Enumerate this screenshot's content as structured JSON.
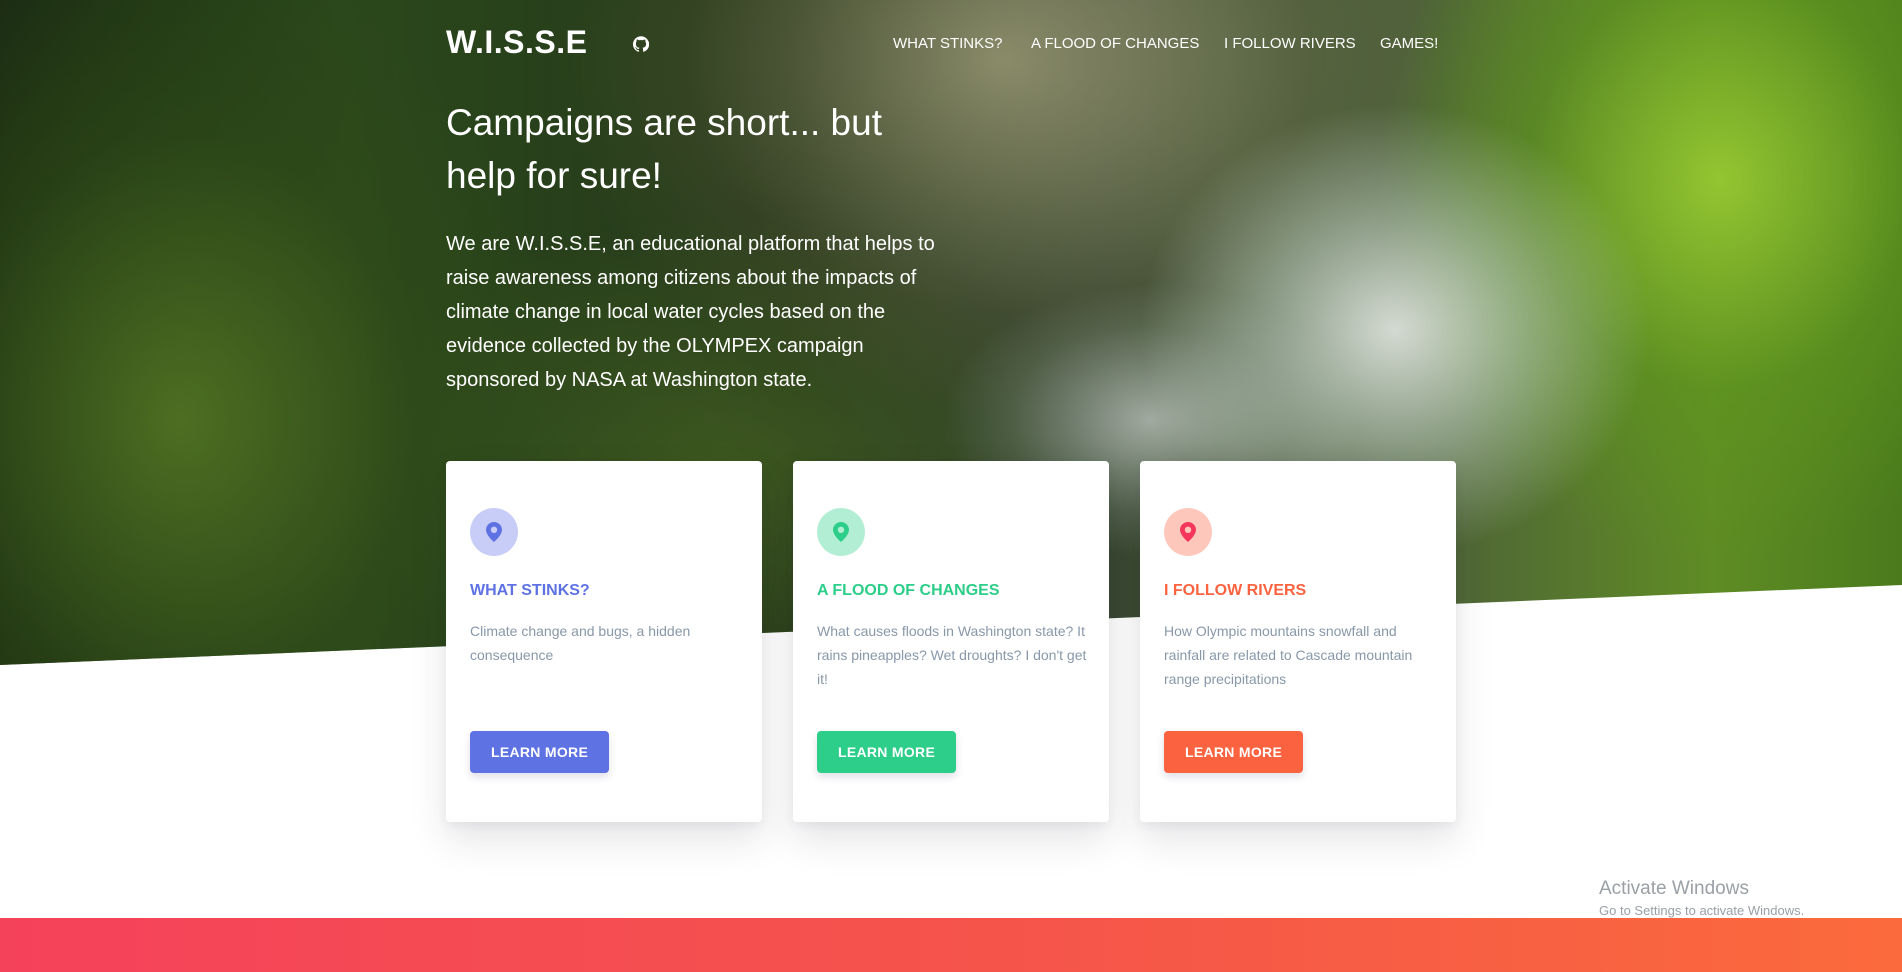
{
  "brand": {
    "name": "W.I.S.S.E",
    "github_icon": "github-icon"
  },
  "nav": {
    "items": [
      {
        "label": "WHAT STINKS?"
      },
      {
        "label": "A FLOOD OF CHANGES"
      },
      {
        "label": "I FOLLOW RIVERS"
      },
      {
        "label": "GAMES!"
      }
    ]
  },
  "hero": {
    "headline": "Campaigns are short... but help for sure!",
    "description": "We are W.I.S.S.E, an educational platform that helps to raise awareness among citizens about the impacts of climate change in local water cycles based on the evidence collected by the OLYMPEX campaign sponsored by NASA at Washington state."
  },
  "cards": [
    {
      "icon": "map-pin-icon",
      "title": "WHAT STINKS?",
      "text": "Climate change and bugs, a hidden consequence",
      "button": "LEARN MORE",
      "accent": "#5e72e4",
      "icon_bg": "#c7cdf7"
    },
    {
      "icon": "map-pin-icon",
      "title": "A FLOOD OF CHANGES",
      "text": "What causes floods in Washington state? It rains pineapples? Wet droughts? I don't get it!",
      "button": "LEARN MORE",
      "accent": "#2dce89",
      "icon_bg": "#b2eed3"
    },
    {
      "icon": "map-pin-icon",
      "title": "I FOLLOW RIVERS",
      "text": "How Olympic mountains snowfall and rainfall are related to Cascade mountain range precipitations",
      "button": "LEARN MORE",
      "accent": "#fb6340",
      "icon_bg": "#fdc8bb"
    }
  ],
  "watermark": {
    "title": "Activate Windows",
    "subtitle": "Go to Settings to activate Windows."
  }
}
